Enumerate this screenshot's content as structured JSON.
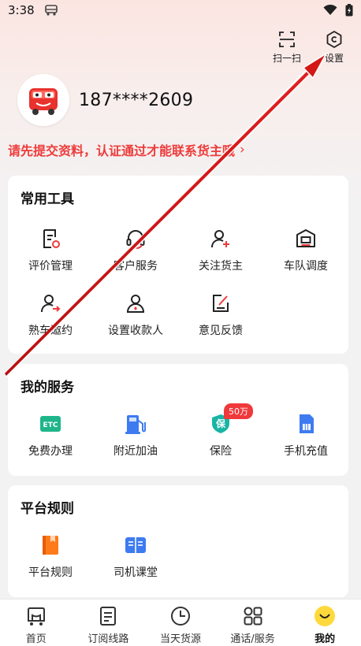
{
  "status_bar": {
    "time": "3:38"
  },
  "top_actions": {
    "scan_label": "扫一扫",
    "settings_label": "设置"
  },
  "profile": {
    "phone": "187****2609"
  },
  "notice": {
    "text": "请先提交资料，认证通过才能联系货主哦",
    "chevron": "›"
  },
  "tools": {
    "title": "常用工具",
    "items": [
      {
        "label": "评价管理",
        "icon": "review-icon"
      },
      {
        "label": "客户服务",
        "icon": "headset-icon"
      },
      {
        "label": "关注货主",
        "icon": "follow-user-icon"
      },
      {
        "label": "车队调度",
        "icon": "fleet-icon"
      },
      {
        "label": "熟车邀约",
        "icon": "invite-user-icon"
      },
      {
        "label": "设置收款人",
        "icon": "payee-icon"
      },
      {
        "label": "意见反馈",
        "icon": "feedback-icon"
      }
    ]
  },
  "services": {
    "title": "我的服务",
    "items": [
      {
        "label": "免费办理",
        "icon": "etc-icon",
        "icon_text": "ETC"
      },
      {
        "label": "附近加油",
        "icon": "fuel-icon"
      },
      {
        "label": "保险",
        "icon": "insurance-icon",
        "icon_text": "保",
        "badge": "50万"
      },
      {
        "label": "手机充值",
        "icon": "sim-card-icon"
      }
    ]
  },
  "rules": {
    "title": "平台规则",
    "items": [
      {
        "label": "平台规则",
        "icon": "rulebook-icon"
      },
      {
        "label": "司机课堂",
        "icon": "classroom-icon"
      }
    ]
  },
  "tabbar": {
    "items": [
      {
        "label": "首页",
        "icon": "home-truck-icon"
      },
      {
        "label": "订阅线路",
        "icon": "subscribe-icon"
      },
      {
        "label": "当天货源",
        "icon": "clock-icon"
      },
      {
        "label": "通话/服务",
        "icon": "apps-icon"
      },
      {
        "label": "我的",
        "icon": "mine-icon",
        "active": true
      }
    ]
  },
  "colors": {
    "accent_red": "#ee3b3b",
    "badge_red": "#f0393a",
    "etc_green": "#1fb58a",
    "fuel_blue": "#3e7bf0",
    "rule_orange": "#ff7a1a",
    "mine_yellow": "#ffd93b"
  }
}
